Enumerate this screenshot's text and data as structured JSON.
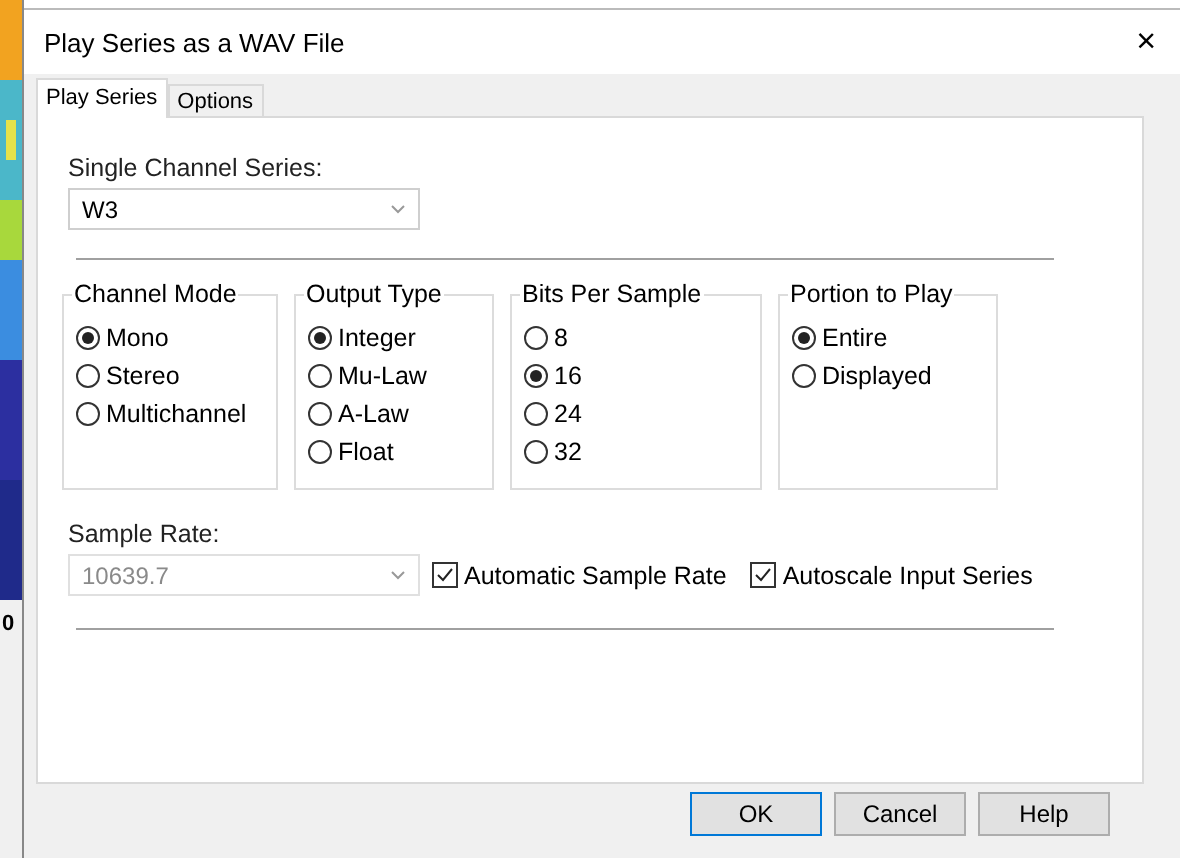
{
  "background": {
    "kind": "picture",
    "axis_label": "0"
  },
  "window": {
    "title": "Play Series as a WAV File",
    "close": "×"
  },
  "tabs": [
    {
      "label": "Play Series",
      "selected": true
    },
    {
      "label": "Options",
      "selected": false
    }
  ],
  "series": {
    "label": "Single Channel Series:",
    "value": "W3",
    "disabled": false
  },
  "groups": [
    {
      "title": "Channel Mode",
      "options": [
        {
          "label": "Mono",
          "selected": true
        },
        {
          "label": "Stereo",
          "selected": false
        },
        {
          "label": "Multichannel",
          "selected": false
        }
      ]
    },
    {
      "title": "Output Type",
      "options": [
        {
          "label": "Integer",
          "selected": true
        },
        {
          "label": "Mu-Law",
          "selected": false
        },
        {
          "label": "A-Law",
          "selected": false
        },
        {
          "label": "Float",
          "selected": false
        }
      ]
    },
    {
      "title": "Bits Per Sample",
      "options": [
        {
          "label": "8",
          "selected": false
        },
        {
          "label": "16",
          "selected": true
        },
        {
          "label": "24",
          "selected": false
        },
        {
          "label": "32",
          "selected": false
        }
      ]
    },
    {
      "title": "Portion to Play",
      "options": [
        {
          "label": "Entire",
          "selected": true
        },
        {
          "label": "Displayed",
          "selected": false
        }
      ]
    }
  ],
  "sample_rate": {
    "label": "Sample Rate:",
    "value": "10639.7",
    "disabled": true
  },
  "checkboxes": [
    {
      "label": "Automatic Sample Rate",
      "checked": true
    },
    {
      "label": "Autoscale Input Series",
      "checked": true
    }
  ],
  "buttons": [
    {
      "label": "OK",
      "default": true
    },
    {
      "label": "Cancel",
      "default": false
    },
    {
      "label": "Help",
      "default": false
    }
  ]
}
